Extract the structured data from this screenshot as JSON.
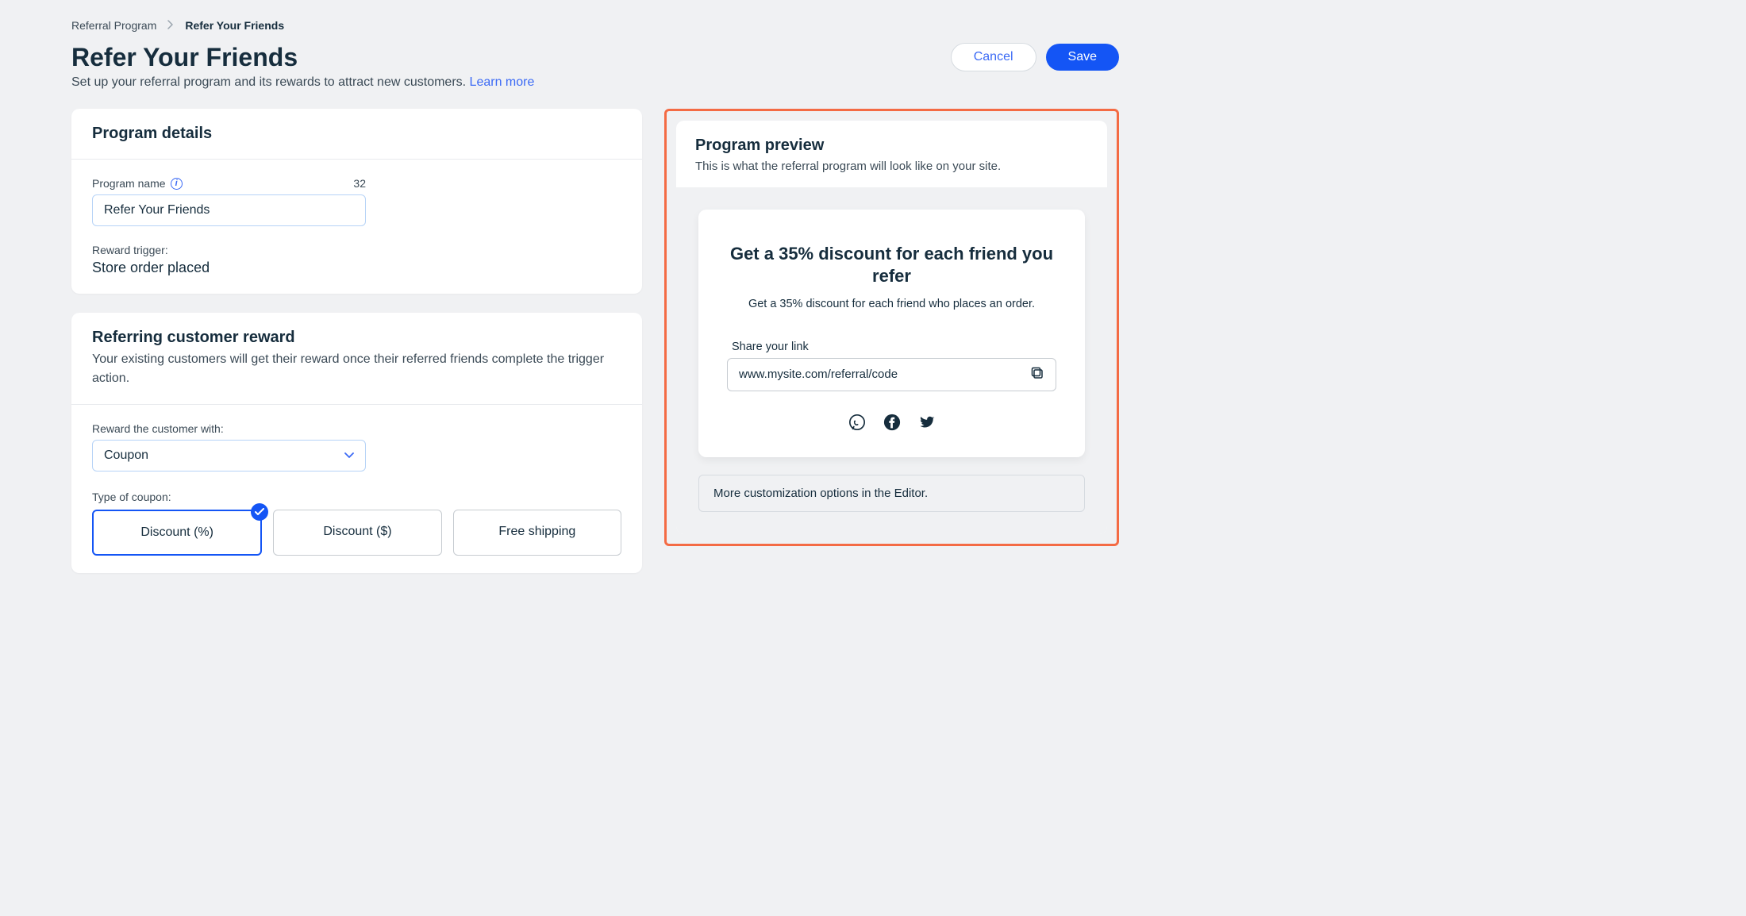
{
  "breadcrumb": {
    "parent": "Referral Program",
    "current": "Refer Your Friends"
  },
  "header": {
    "title": "Refer Your Friends",
    "subtitle": "Set up your referral program and its rewards to attract new customers. ",
    "learn_more": "Learn more"
  },
  "actions": {
    "cancel": "Cancel",
    "save": "Save"
  },
  "program_details": {
    "title": "Program details",
    "name_label": "Program name",
    "name_counter": "32",
    "name_value": "Refer Your Friends",
    "trigger_label": "Reward trigger:",
    "trigger_value": "Store order placed"
  },
  "referring_reward": {
    "title": "Referring customer reward",
    "desc": "Your existing customers will get their reward once their referred friends complete the trigger action.",
    "reward_with_label": "Reward the customer with:",
    "reward_with_value": "Coupon",
    "type_label": "Type of coupon:",
    "options": {
      "percent": "Discount (%)",
      "dollar": "Discount ($)",
      "shipping": "Free shipping"
    }
  },
  "preview": {
    "title": "Program preview",
    "desc": "This is what the referral program will look like on your site.",
    "headline": "Get a 35% discount for each friend you refer",
    "sub": "Get a 35% discount for each friend who places an order.",
    "share_label": "Share your link",
    "link": "www.mysite.com/referral/code",
    "more_options": "More customization options in the Editor."
  }
}
